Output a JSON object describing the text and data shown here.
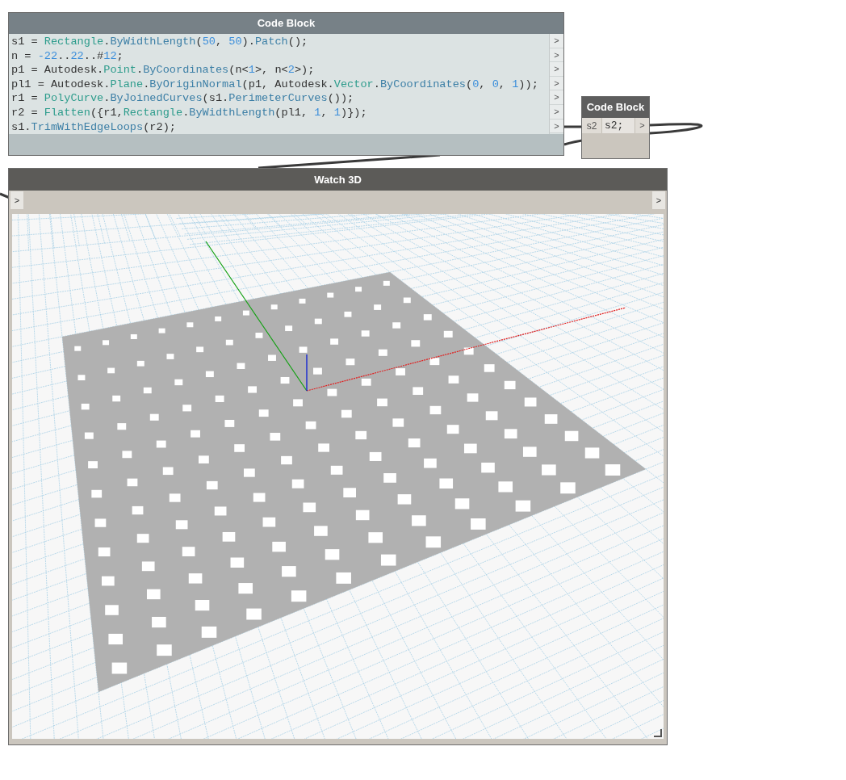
{
  "code_block": {
    "title": "Code Block",
    "lines": [
      {
        "port": ">",
        "tokens": [
          {
            "text": "s1 = ",
            "kind": "plain"
          },
          {
            "text": "Rectangle",
            "kind": "type"
          },
          {
            "text": ".",
            "kind": "plain"
          },
          {
            "text": "ByWidthLength",
            "kind": "method"
          },
          {
            "text": "(",
            "kind": "plain"
          },
          {
            "text": "50",
            "kind": "number"
          },
          {
            "text": ", ",
            "kind": "plain"
          },
          {
            "text": "50",
            "kind": "number"
          },
          {
            "text": ").",
            "kind": "plain"
          },
          {
            "text": "Patch",
            "kind": "method"
          },
          {
            "text": "();",
            "kind": "plain"
          }
        ]
      },
      {
        "port": ">",
        "tokens": [
          {
            "text": "n = ",
            "kind": "plain"
          },
          {
            "text": "-22",
            "kind": "number"
          },
          {
            "text": "..",
            "kind": "plain"
          },
          {
            "text": "22",
            "kind": "number"
          },
          {
            "text": "..#",
            "kind": "plain"
          },
          {
            "text": "12",
            "kind": "number"
          },
          {
            "text": ";",
            "kind": "plain"
          }
        ]
      },
      {
        "port": ">",
        "tokens": [
          {
            "text": "p1 = Autodesk.",
            "kind": "plain"
          },
          {
            "text": "Point",
            "kind": "type"
          },
          {
            "text": ".",
            "kind": "plain"
          },
          {
            "text": "ByCoordinates",
            "kind": "method"
          },
          {
            "text": "(n<",
            "kind": "plain"
          },
          {
            "text": "1",
            "kind": "number"
          },
          {
            "text": ">, n<",
            "kind": "plain"
          },
          {
            "text": "2",
            "kind": "number"
          },
          {
            "text": ">);",
            "kind": "plain"
          }
        ]
      },
      {
        "port": ">",
        "tokens": [
          {
            "text": "pl1 = Autodesk.",
            "kind": "plain"
          },
          {
            "text": "Plane",
            "kind": "type"
          },
          {
            "text": ".",
            "kind": "plain"
          },
          {
            "text": "ByOriginNormal",
            "kind": "method"
          },
          {
            "text": "(p1, Autodesk.",
            "kind": "plain"
          },
          {
            "text": "Vector",
            "kind": "type"
          },
          {
            "text": ".",
            "kind": "plain"
          },
          {
            "text": "ByCoordinates",
            "kind": "method"
          },
          {
            "text": "(",
            "kind": "plain"
          },
          {
            "text": "0",
            "kind": "number"
          },
          {
            "text": ", ",
            "kind": "plain"
          },
          {
            "text": "0",
            "kind": "number"
          },
          {
            "text": ", ",
            "kind": "plain"
          },
          {
            "text": "1",
            "kind": "number"
          },
          {
            "text": "));",
            "kind": "plain"
          }
        ]
      },
      {
        "port": ">",
        "tokens": [
          {
            "text": "r1 = ",
            "kind": "plain"
          },
          {
            "text": "PolyCurve",
            "kind": "type"
          },
          {
            "text": ".",
            "kind": "plain"
          },
          {
            "text": "ByJoinedCurves",
            "kind": "method"
          },
          {
            "text": "(s1.",
            "kind": "plain"
          },
          {
            "text": "PerimeterCurves",
            "kind": "method"
          },
          {
            "text": "());",
            "kind": "plain"
          }
        ]
      },
      {
        "port": ">",
        "tokens": [
          {
            "text": "r2 = ",
            "kind": "plain"
          },
          {
            "text": "Flatten",
            "kind": "type"
          },
          {
            "text": "({r1,",
            "kind": "plain"
          },
          {
            "text": "Rectangle",
            "kind": "type"
          },
          {
            "text": ".",
            "kind": "plain"
          },
          {
            "text": "ByWidthLength",
            "kind": "method"
          },
          {
            "text": "(pl1, ",
            "kind": "plain"
          },
          {
            "text": "1",
            "kind": "number"
          },
          {
            "text": ", ",
            "kind": "plain"
          },
          {
            "text": "1",
            "kind": "number"
          },
          {
            "text": ")});",
            "kind": "plain"
          }
        ]
      },
      {
        "port": ">",
        "tokens": [
          {
            "text": "s1.",
            "kind": "plain"
          },
          {
            "text": "TrimWithEdgeLoops",
            "kind": "method"
          },
          {
            "text": "(r2);",
            "kind": "plain"
          }
        ]
      }
    ]
  },
  "small_block": {
    "title": "Code Block",
    "input_port": "s2",
    "code": "s2;",
    "output_port": ">"
  },
  "watch_3d": {
    "title": "Watch 3D",
    "input_port": ">",
    "output_port": ">"
  }
}
